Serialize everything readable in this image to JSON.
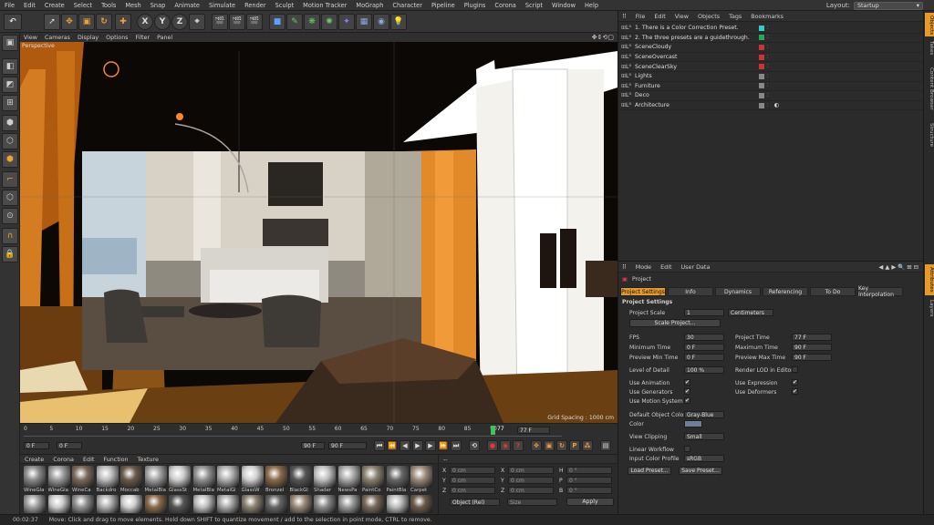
{
  "menubar": {
    "items": [
      "File",
      "Edit",
      "Create",
      "Select",
      "Tools",
      "Mesh",
      "Snap",
      "Animate",
      "Simulate",
      "Render",
      "Sculpt",
      "Motion Tracker",
      "MoGraph",
      "Character",
      "Pipeline",
      "Plugins",
      "Corona",
      "Script",
      "Window",
      "Help"
    ],
    "layout_label": "Layout:",
    "layout_value": "Startup"
  },
  "viewport": {
    "menu": [
      "View",
      "Cameras",
      "Display",
      "Options",
      "Filter",
      "Panel"
    ],
    "camera_label": "Perspective",
    "grid_spacing": "Grid Spacing : 1000 cm"
  },
  "timeline": {
    "ticks": [
      "0",
      "5",
      "10",
      "15",
      "20",
      "25",
      "30",
      "35",
      "40",
      "45",
      "50",
      "55",
      "60",
      "65",
      "70",
      "75",
      "80",
      "85",
      "90"
    ],
    "current_frame": "77",
    "end_frame_field": "77 F",
    "start_field": "0 F",
    "min_field": "0 F",
    "max_field": "90 F",
    "end_field": "90 F"
  },
  "materials": {
    "menu": [
      "Create",
      "Corona",
      "Edit",
      "Function",
      "Texture"
    ],
    "row1": [
      "WineGla",
      "WineGla",
      "WineCa",
      "Backdro",
      "Moccab",
      "MetalBla",
      "GlassSt",
      "MetalBla",
      "MetalGl",
      "GlassW",
      "Bronzel",
      "BlackGl",
      "Shader",
      "NewsPa",
      "PaintCo",
      "PaintBla",
      "Carpet"
    ]
  },
  "coords": {
    "header": "--",
    "rows": [
      {
        "a": "X",
        "av": "0 cm",
        "b": "X",
        "bv": "0 cm",
        "c": "H",
        "cv": "0 °"
      },
      {
        "a": "Y",
        "av": "0 cm",
        "b": "Y",
        "bv": "0 cm",
        "c": "P",
        "cv": "0 °"
      },
      {
        "a": "Z",
        "av": "0 cm",
        "b": "Z",
        "bv": "0 cm",
        "c": "B",
        "cv": "0 °"
      }
    ],
    "mode_select": "Object (Rel)",
    "size_select": "Size",
    "apply_label": "Apply"
  },
  "status": {
    "time": "00:02:37",
    "message": "Move: Click and drag to move elements. Hold down SHIFT to quantize movement / add to the selection in point mode, CTRL to remove."
  },
  "objects": {
    "menu": [
      "File",
      "Edit",
      "View",
      "Objects",
      "Tags",
      "Bookmarks"
    ],
    "items": [
      {
        "name": "1. There is a Color Correction Preset.",
        "color": "#33cccc"
      },
      {
        "name": "2. The three presets are a guidethrough.",
        "color": "#22aa55"
      },
      {
        "name": "SceneCloudy",
        "color": "#cc3333"
      },
      {
        "name": "SceneOvercast",
        "color": "#cc3333"
      },
      {
        "name": "SceneClearSky",
        "color": "#cc3333"
      },
      {
        "name": "Lights",
        "color": "#888888"
      },
      {
        "name": "Furniture",
        "color": "#888888"
      },
      {
        "name": "Deco",
        "color": "#888888"
      },
      {
        "name": "Architecture",
        "color": "#888888"
      }
    ]
  },
  "attributes": {
    "menu": [
      "Mode",
      "Edit",
      "User Data"
    ],
    "object_name": "Project",
    "tabs": [
      "Project Settings",
      "Info",
      "Dynamics",
      "Referencing",
      "To Do",
      "Key Interpolation"
    ],
    "section": "Project Settings",
    "project_scale_label": "Project Scale",
    "project_scale_value": "1",
    "project_scale_unit": "Centimeters",
    "scale_project_button": "Scale Project...",
    "fps_label": "FPS",
    "fps_value": "30",
    "project_time_label": "Project Time",
    "project_time_value": "77 F",
    "min_time_label": "Minimum Time",
    "min_time_value": "0 F",
    "max_time_label": "Maximum Time",
    "max_time_value": "90 F",
    "preview_min_label": "Preview Min Time",
    "preview_min_value": "0 F",
    "preview_max_label": "Preview Max Time",
    "preview_max_value": "90 F",
    "lod_label": "Level of Detail",
    "lod_value": "100 %",
    "render_lod_label": "Render LOD in Editor",
    "use_animation": "Use Animation",
    "use_expression": "Use Expression",
    "use_generators": "Use Generators",
    "use_deformers": "Use Deformers",
    "use_motion_system": "Use Motion System",
    "default_color_label": "Default Object Color",
    "default_color_value": "Gray-Blue",
    "color_label": "Color",
    "view_clipping_label": "View Clipping",
    "view_clipping_value": "Small",
    "linear_workflow_label": "Linear Workflow",
    "input_color_profile_label": "Input Color Profile",
    "input_color_profile_value": "sRGB",
    "load_preset": "Load Preset...",
    "save_preset": "Save Preset..."
  },
  "right_tabs_top": [
    "Objects",
    "Takes",
    "Content Browser",
    "Structure"
  ],
  "right_tabs_bottom": [
    "Attributes",
    "Layers"
  ]
}
